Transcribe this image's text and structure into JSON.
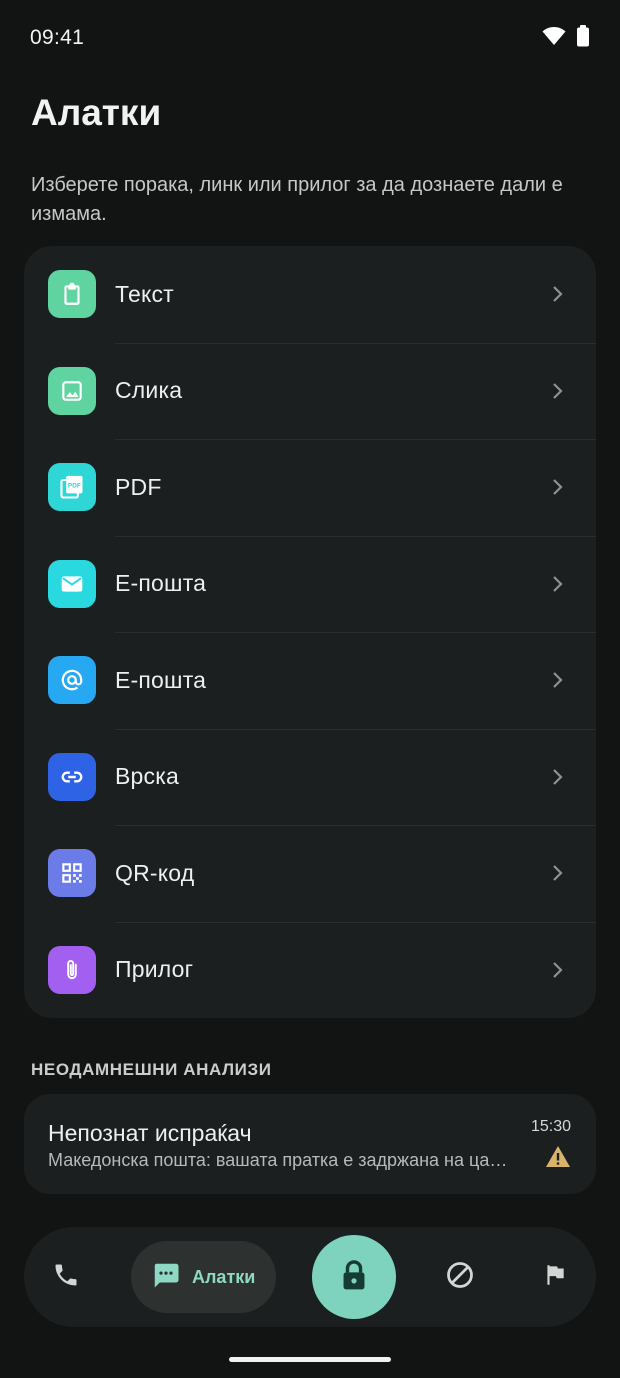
{
  "status_bar": {
    "time": "09:41"
  },
  "header": {
    "title": "Алатки",
    "subtitle": "Изберете порака, линк или прилог за да дознаете дали е измама."
  },
  "tools": [
    {
      "label": "Текст",
      "icon": "clipboard-icon",
      "color": "#5fd3a0"
    },
    {
      "label": "Слика",
      "icon": "image-icon",
      "color": "#5fd3a0"
    },
    {
      "label": "PDF",
      "icon": "pdf-icon",
      "color": "#2ed6d6"
    },
    {
      "label": "Е-пошта",
      "icon": "envelope-icon",
      "color": "#2ad9e0"
    },
    {
      "label": "Е-пошта",
      "icon": "at-sign-icon",
      "color": "#27a8f2"
    },
    {
      "label": "Врска",
      "icon": "link-icon",
      "color": "#2f63e6"
    },
    {
      "label": "QR-код",
      "icon": "qr-code-icon",
      "color": "#6b7ce8"
    },
    {
      "label": "Прилог",
      "icon": "paperclip-icon",
      "color": "#a35ff0"
    }
  ],
  "recent": {
    "header": "НЕОДАМНЕШНИ АНАЛИЗИ",
    "items": [
      {
        "title": "Непознат испраќач",
        "preview": "Македонска пошта: вашата пратка е задржана на царина",
        "time": "15:30",
        "status_icon": "warning-icon",
        "status_color": "#d7b46a"
      }
    ]
  },
  "bottom_nav": {
    "items": [
      {
        "name": "phone",
        "icon": "phone-icon"
      },
      {
        "name": "tools",
        "icon": "message-icon",
        "label": "Алатки",
        "active": true
      },
      {
        "name": "protect",
        "icon": "lock-icon"
      },
      {
        "name": "blocked",
        "icon": "block-icon"
      },
      {
        "name": "reports",
        "icon": "flag-icon"
      }
    ],
    "active_color": "#8ed9c3",
    "center_color": "#7ed3bf"
  }
}
